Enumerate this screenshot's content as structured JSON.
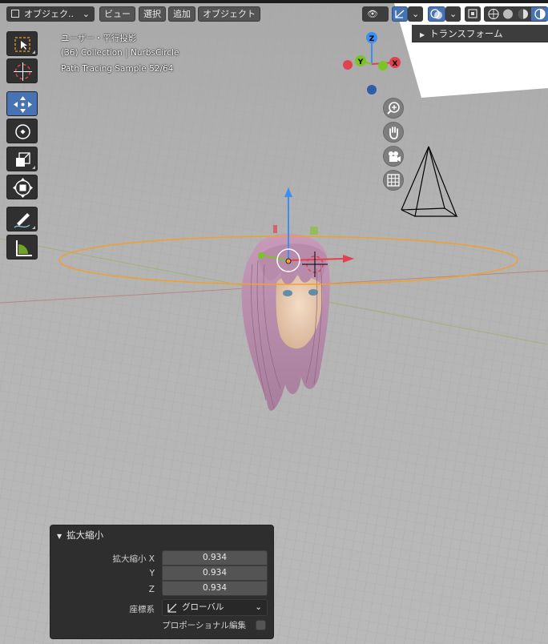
{
  "header": {
    "mode_label": "オブジェク..",
    "menus": [
      "ビュー",
      "選択",
      "追加",
      "オブジェクト"
    ]
  },
  "overlay": {
    "view_name": "ユーザー・平行投影",
    "collection": "(36) Collection | NurbsCircle",
    "render_status": "Path Tracing Sample 52/64"
  },
  "gizmo": {
    "x": "X",
    "y": "Y",
    "z": "Z"
  },
  "n_panel": {
    "transform_label": "トランスフォーム"
  },
  "operator_panel": {
    "title": "拡大縮小",
    "scale_label": "拡大縮小 X",
    "y_label": "Y",
    "z_label": "Z",
    "scale_x": "0.934",
    "scale_y": "0.934",
    "scale_z": "0.934",
    "orientation_label": "座標系",
    "orientation_value": "グローバル",
    "proportional_label": "プロポーショナル編集"
  },
  "colors": {
    "accent_blue": "#4772b3",
    "axis_x": "#e2424f",
    "axis_y": "#7ec324",
    "axis_z": "#3b8ef2",
    "curve_orange": "#f0a030"
  }
}
